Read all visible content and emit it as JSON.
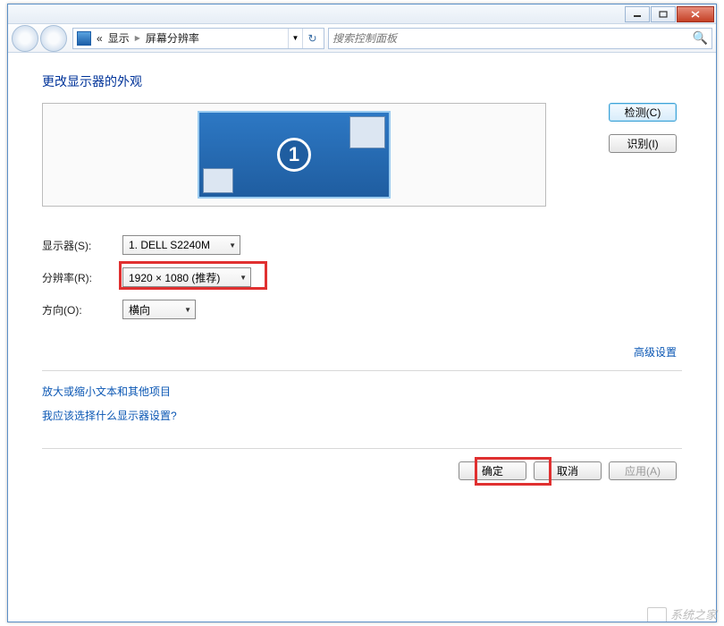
{
  "breadcrumb": {
    "prefix": "«",
    "item1": "显示",
    "item2": "屏幕分辨率"
  },
  "search": {
    "placeholder": "搜索控制面板"
  },
  "heading": "更改显示器的外观",
  "preview": {
    "number": "1"
  },
  "buttons": {
    "detect": "检测(C)",
    "identify": "识别(I)"
  },
  "form": {
    "display_label": "显示器(S):",
    "display_value": "1. DELL S2240M",
    "resolution_label": "分辨率(R):",
    "resolution_value": "1920 × 1080 (推荐)",
    "orientation_label": "方向(O):",
    "orientation_value": "横向"
  },
  "links": {
    "advanced": "高级设置",
    "resize": "放大或缩小文本和其他项目",
    "which": "我应该选择什么显示器设置?"
  },
  "footer": {
    "ok": "确定",
    "cancel": "取消",
    "apply": "应用(A)"
  },
  "watermark": "系统之家"
}
